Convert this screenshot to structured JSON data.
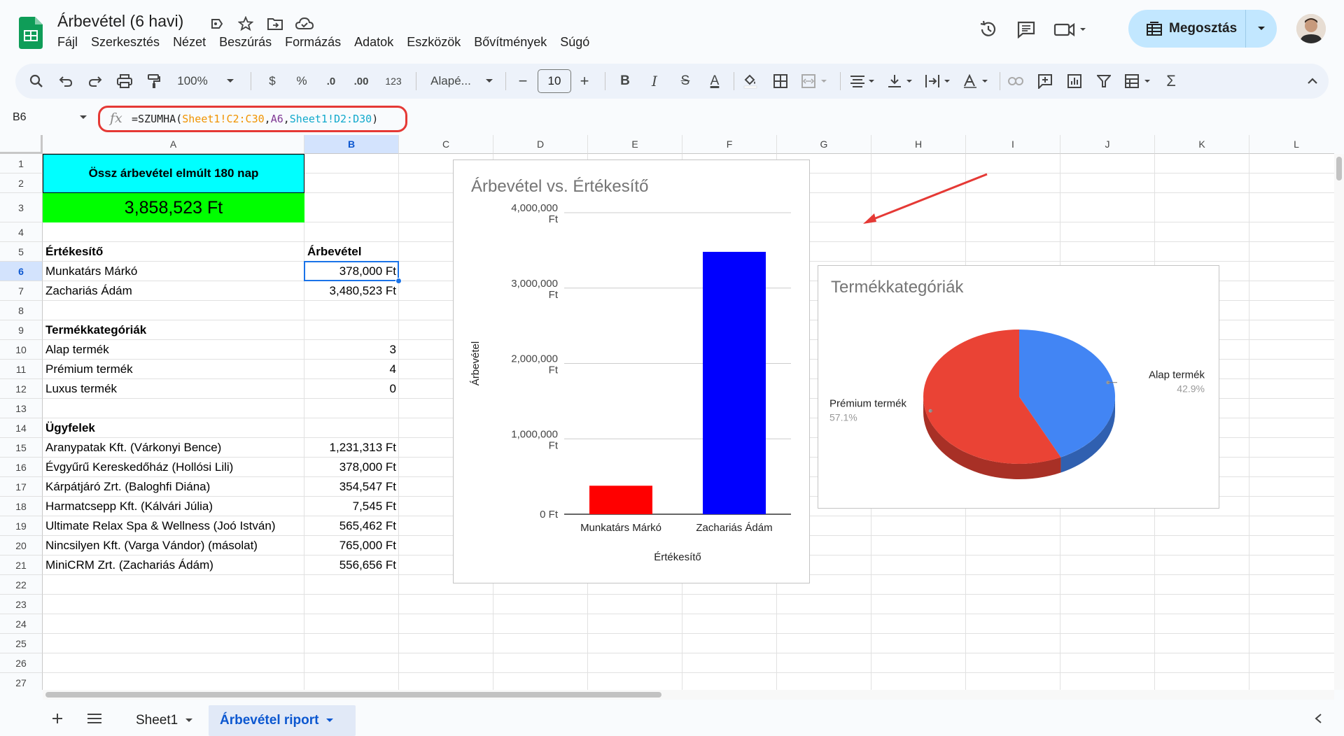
{
  "doc": {
    "title": "Árbevétel (6 havi)"
  },
  "menu": [
    "Fájl",
    "Szerkesztés",
    "Nézet",
    "Beszúrás",
    "Formázás",
    "Adatok",
    "Eszközök",
    "Bővítmények",
    "Súgó"
  ],
  "share": {
    "label": "Megosztás"
  },
  "toolbar": {
    "zoom": "100%",
    "currency": "$",
    "percent": "%",
    "dec_decrease": ".0",
    "dec_increase": ".00",
    "number_format": "123",
    "font": "Alapé...",
    "font_size": "10",
    "minus": "−",
    "plus": "+",
    "bold": "B",
    "italic": "I",
    "strike": "S",
    "text_color": "A",
    "sum": "Σ"
  },
  "formula_bar": {
    "cell_ref": "B6",
    "parts": [
      "=SZUMHA(",
      "Sheet1!C2:C30",
      ",",
      "A6",
      ",",
      "Sheet1!D2:D30",
      ")"
    ]
  },
  "columns": [
    "A",
    "B",
    "C",
    "D",
    "E",
    "F",
    "G",
    "H",
    "I",
    "J",
    "K",
    "L"
  ],
  "rows": [
    "1",
    "2",
    "3",
    "4",
    "5",
    "6",
    "7",
    "8",
    "9",
    "10",
    "11",
    "12",
    "13",
    "14",
    "15",
    "16",
    "17",
    "18",
    "19",
    "20",
    "21",
    "22",
    "23",
    "24",
    "25",
    "26",
    "27"
  ],
  "cells": {
    "header_title": "Össz árbevétel elmúlt 180 nap",
    "total": "3,858,523 Ft",
    "sales_header": "Értékesítő",
    "revenue_header": "Árbevétel",
    "sales": [
      {
        "name": "Munkatárs Márkó",
        "value": "378,000 Ft"
      },
      {
        "name": "Zachariás Ádám",
        "value": "3,480,523 Ft"
      }
    ],
    "categories_header": "Termékkategóriák",
    "categories": [
      {
        "name": "Alap termék",
        "value": "3"
      },
      {
        "name": "Prémium termék",
        "value": "4"
      },
      {
        "name": "Luxus termék",
        "value": "0"
      }
    ],
    "clients_header": "Ügyfelek",
    "clients": [
      {
        "name": "Aranypatak Kft. (Várkonyi Bence)",
        "value": "1,231,313 Ft"
      },
      {
        "name": "Évgyűrű Kereskedőház (Hollósi Lili)",
        "value": "378,000 Ft"
      },
      {
        "name": "Kárpátjáró Zrt. (Baloghfi Diána)",
        "value": "354,547 Ft"
      },
      {
        "name": "Harmatcsepp Kft. (Kálvári Júlia)",
        "value": "7,545 Ft"
      },
      {
        "name": "Ultimate Relax Spa & Wellness (Joó István)",
        "value": "565,462 Ft"
      },
      {
        "name": "Nincsilyen Kft. (Varga Vándor) (másolat)",
        "value": "765,000 Ft"
      },
      {
        "name": "MiniCRM Zrt. (Zachariás Ádám)",
        "value": "556,656 Ft"
      }
    ]
  },
  "chart_data": [
    {
      "type": "bar",
      "title": "Árbevétel vs. Értékesítő",
      "xlabel": "Értékesítő",
      "ylabel": "Árbevétel",
      "categories": [
        "Munkatárs Márkó",
        "Zachariás Ádám"
      ],
      "values": [
        378000,
        3480523
      ],
      "bar_colors": [
        "#ff0000",
        "#0000ff"
      ],
      "ylim": [
        0,
        4000000
      ],
      "yticks": [
        {
          "value": 0,
          "label": "0 Ft"
        },
        {
          "value": 1000000,
          "label": "1,000,000 Ft"
        },
        {
          "value": 2000000,
          "label": "2,000,000 Ft"
        },
        {
          "value": 3000000,
          "label": "3,000,000 Ft"
        },
        {
          "value": 4000000,
          "label": "4,000,000 Ft"
        }
      ],
      "grid": true
    },
    {
      "type": "pie",
      "title": "Termékkategóriák",
      "slices": [
        {
          "label": "Alap termék",
          "percent": "42.9%",
          "value": 3,
          "color": "#4285f4"
        },
        {
          "label": "Prémium termék",
          "percent": "57.1%",
          "value": 4,
          "color": "#ea4335"
        }
      ],
      "style": "3d"
    }
  ],
  "sheets": [
    {
      "name": "Sheet1",
      "active": false
    },
    {
      "name": "Árbevétel riport",
      "active": true
    }
  ],
  "colors": {
    "accent": "#0b57d0",
    "share_bg": "#c2e7ff",
    "highlight": "#e53935"
  }
}
